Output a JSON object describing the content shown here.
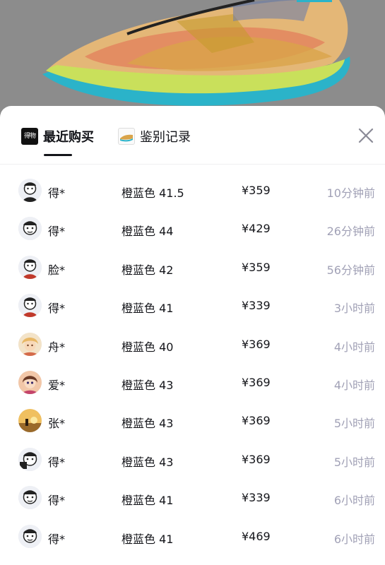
{
  "tabs": [
    {
      "label": "最近购买",
      "icon": "dewu-logo-icon",
      "active": true
    },
    {
      "label": "鉴别记录",
      "icon": "shoe-thumbnail-icon",
      "active": false
    }
  ],
  "app_logo_text": "得物",
  "close_icon": "close-icon",
  "purchases": [
    {
      "user": "得*",
      "spec": "橙蓝色 41.5",
      "price": "¥359",
      "time": "10分钟前",
      "avatar": "avatar-cartoon-icon"
    },
    {
      "user": "得*",
      "spec": "橙蓝色 44",
      "price": "¥429",
      "time": "26分钟前",
      "avatar": "avatar-cartoon-icon"
    },
    {
      "user": "脸*",
      "spec": "橙蓝色 42",
      "price": "¥359",
      "time": "56分钟前",
      "avatar": "avatar-cartoon-icon"
    },
    {
      "user": "得*",
      "spec": "橙蓝色 41",
      "price": "¥339",
      "time": "3小时前",
      "avatar": "avatar-cartoon-icon"
    },
    {
      "user": "舟*",
      "spec": "橙蓝色 40",
      "price": "¥369",
      "time": "4小时前",
      "avatar": "avatar-anime-icon"
    },
    {
      "user": "爱*",
      "spec": "橙蓝色 43",
      "price": "¥369",
      "time": "4小时前",
      "avatar": "avatar-doll-icon"
    },
    {
      "user": "张*",
      "spec": "橙蓝色 43",
      "price": "¥369",
      "time": "5小时前",
      "avatar": "avatar-sunset-icon"
    },
    {
      "user": "得*",
      "spec": "橙蓝色 43",
      "price": "¥369",
      "time": "5小时前",
      "avatar": "avatar-cartoon-icon"
    },
    {
      "user": "得*",
      "spec": "橙蓝色 41",
      "price": "¥339",
      "time": "6小时前",
      "avatar": "avatar-cartoon-icon"
    },
    {
      "user": "得*",
      "spec": "橙蓝色 41",
      "price": "¥469",
      "time": "6小时前",
      "avatar": "avatar-cartoon-icon"
    }
  ],
  "colors": {
    "text_primary": "#14151a",
    "text_secondary": "#a1a1b6",
    "sheet_bg": "#ffffff",
    "overlay_bg": "#7b7b7b"
  }
}
